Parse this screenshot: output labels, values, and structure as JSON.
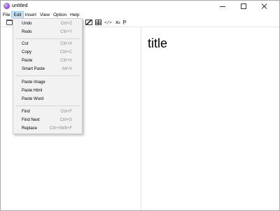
{
  "window": {
    "title": "untitled",
    "icon": "app-logo-icon"
  },
  "menubar": {
    "items": [
      {
        "label": "File"
      },
      {
        "label": "Edit"
      },
      {
        "label": "Insert"
      },
      {
        "label": "View"
      },
      {
        "label": "Option"
      },
      {
        "label": "Help"
      }
    ],
    "active": "Edit"
  },
  "toolbar": {
    "icons": [
      "folder-open-icon",
      "image-icon",
      "table-icon",
      "code-icon",
      "superscript-icon",
      "pilcrow-icon"
    ],
    "code_glyph": "</>",
    "superscript_base": "x",
    "superscript_exp": "2",
    "pilcrow_glyph": "Ᵽ"
  },
  "edit_menu": {
    "groups": [
      [
        {
          "label": "Undo",
          "shortcut": "Ctrl+Z"
        },
        {
          "label": "Redo",
          "shortcut": "Ctrl+Y"
        }
      ],
      [
        {
          "label": "Cut",
          "shortcut": "Ctrl+X"
        },
        {
          "label": "Copy",
          "shortcut": "Ctrl+C"
        },
        {
          "label": "Paste",
          "shortcut": "Ctrl+V"
        },
        {
          "label": "Smart Paste",
          "shortcut": "Alt+V"
        }
      ],
      [
        {
          "label": "Paste Image",
          "shortcut": ""
        },
        {
          "label": "Paste Html",
          "shortcut": ""
        },
        {
          "label": "Paste Word",
          "shortcut": ""
        }
      ],
      [
        {
          "label": "Find",
          "shortcut": "Ctrl+F"
        },
        {
          "label": "Find Next",
          "shortcut": "Ctrl+G"
        },
        {
          "label": "Replace",
          "shortcut": "Ctrl+Shift+F"
        }
      ]
    ]
  },
  "preview": {
    "heading": "title"
  },
  "colors": {
    "menu_highlight": "#cce4f7",
    "menu_highlight_border": "#99c9ef",
    "dropdown_bg": "#f2f2f2",
    "shortcut_text": "#8a8a8a"
  }
}
